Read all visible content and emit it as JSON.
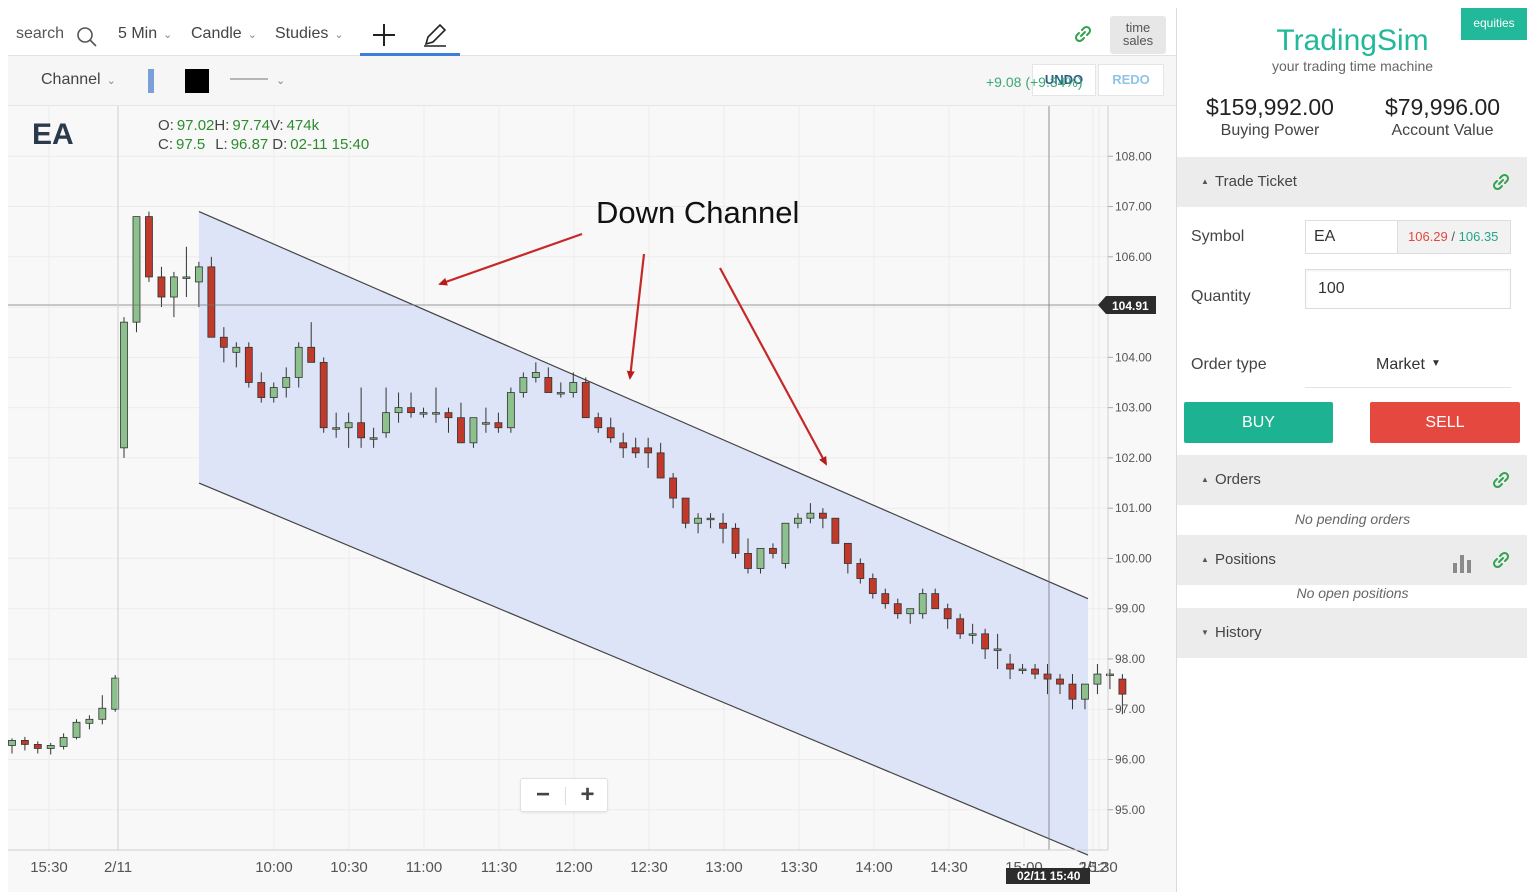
{
  "toolbar": {
    "search_placeholder": "search",
    "interval": "5 Min",
    "chart_type": "Candle",
    "studies": "Studies",
    "time_sales_line1": "time",
    "time_sales_line2": "sales"
  },
  "drawbar": {
    "tool": "Channel",
    "undo": "UNDO",
    "redo": "REDO",
    "change": "+9.08 (+9.34%)",
    "colors": {
      "line_swatch": "#7b9fd8",
      "fill_swatch": "#000000"
    }
  },
  "chart": {
    "symbol": "EA",
    "ohlc": {
      "o_label": "O:",
      "o_value": "97.02",
      "h_label": "H:",
      "h_value": "97.74",
      "v_label": "V:",
      "v_value": "474k",
      "c_label": "C:",
      "c_value": "97.5",
      "l_label": "L:",
      "l_value": "96.87",
      "d_label": "D:",
      "d_value": "02-11 15:40"
    },
    "annotation": "Down Channel",
    "crosshair_price": "104.91",
    "crosshair_time": "02/11 15:40",
    "colors": {
      "up": "#8cc08c",
      "down": "#c0392b",
      "channel_fill": "#dde4f7",
      "arrow": "#c62828"
    }
  },
  "chart_data": {
    "type": "candlestick",
    "y_ticks": [
      "108.00",
      "107.00",
      "106.00",
      "105.00",
      "104.00",
      "103.00",
      "102.00",
      "101.00",
      "100.00",
      "99.00",
      "98.00",
      "97.00",
      "96.00",
      "95.00"
    ],
    "x_ticks": [
      "15:30",
      "2/11",
      "10:00",
      "10:30",
      "11:00",
      "11:30",
      "12:00",
      "12:30",
      "13:00",
      "13:30",
      "14:00",
      "14:30",
      "15:00",
      "15:30",
      "2/12"
    ],
    "ylim": [
      94.2,
      109.0
    ],
    "ohlc": [
      [
        96.28,
        96.42,
        96.12,
        96.38
      ],
      [
        96.38,
        96.45,
        96.18,
        96.3
      ],
      [
        96.3,
        96.36,
        96.12,
        96.22
      ],
      [
        96.22,
        96.33,
        96.1,
        96.28
      ],
      [
        96.26,
        96.52,
        96.2,
        96.44
      ],
      [
        96.44,
        96.8,
        96.4,
        96.74
      ],
      [
        96.72,
        96.88,
        96.6,
        96.8
      ],
      [
        96.8,
        97.28,
        96.7,
        97.02
      ],
      [
        97.0,
        97.68,
        96.95,
        97.62
      ],
      [
        102.2,
        104.8,
        102.0,
        104.7
      ],
      [
        104.7,
        106.8,
        104.5,
        106.8
      ],
      [
        106.8,
        106.9,
        105.5,
        105.6
      ],
      [
        105.6,
        105.8,
        105.0,
        105.2
      ],
      [
        105.2,
        105.7,
        104.8,
        105.6
      ],
      [
        105.6,
        106.2,
        105.2,
        105.6
      ],
      [
        105.5,
        105.9,
        105.0,
        105.8
      ],
      [
        105.8,
        106.0,
        104.4,
        104.4
      ],
      [
        104.4,
        104.6,
        103.9,
        104.2
      ],
      [
        104.1,
        104.3,
        103.8,
        104.2
      ],
      [
        104.2,
        104.3,
        103.4,
        103.5
      ],
      [
        103.5,
        103.7,
        103.1,
        103.2
      ],
      [
        103.2,
        103.5,
        103.1,
        103.4
      ],
      [
        103.4,
        103.8,
        103.2,
        103.6
      ],
      [
        103.6,
        104.3,
        103.4,
        104.2
      ],
      [
        104.2,
        104.7,
        103.9,
        103.9
      ],
      [
        103.9,
        104.0,
        102.5,
        102.6
      ],
      [
        102.6,
        102.9,
        102.4,
        102.6
      ],
      [
        102.6,
        102.9,
        102.2,
        102.7
      ],
      [
        102.7,
        103.4,
        102.2,
        102.4
      ],
      [
        102.4,
        102.6,
        102.2,
        102.4
      ],
      [
        102.5,
        103.4,
        102.4,
        102.9
      ],
      [
        102.9,
        103.3,
        102.7,
        103.0
      ],
      [
        103.0,
        103.3,
        102.8,
        102.9
      ],
      [
        102.9,
        103.0,
        102.8,
        102.9
      ],
      [
        102.9,
        103.4,
        102.7,
        102.9
      ],
      [
        102.9,
        103.0,
        102.5,
        102.8
      ],
      [
        102.8,
        103.1,
        102.3,
        102.3
      ],
      [
        102.3,
        102.8,
        102.2,
        102.8
      ],
      [
        102.7,
        103.0,
        102.5,
        102.7
      ],
      [
        102.7,
        102.9,
        102.5,
        102.6
      ],
      [
        102.6,
        103.4,
        102.5,
        103.3
      ],
      [
        103.3,
        103.7,
        103.2,
        103.6
      ],
      [
        103.6,
        103.9,
        103.5,
        103.7
      ],
      [
        103.6,
        103.8,
        103.3,
        103.3
      ],
      [
        103.3,
        103.5,
        103.2,
        103.3
      ],
      [
        103.3,
        103.7,
        103.2,
        103.5
      ],
      [
        103.5,
        103.6,
        102.8,
        102.8
      ],
      [
        102.8,
        102.9,
        102.5,
        102.6
      ],
      [
        102.6,
        102.8,
        102.3,
        102.4
      ],
      [
        102.3,
        102.5,
        102.0,
        102.2
      ],
      [
        102.2,
        102.4,
        102.0,
        102.1
      ],
      [
        102.2,
        102.4,
        101.8,
        102.1
      ],
      [
        102.1,
        102.3,
        101.6,
        101.6
      ],
      [
        101.6,
        101.7,
        101.0,
        101.2
      ],
      [
        101.2,
        101.2,
        100.6,
        100.7
      ],
      [
        100.7,
        100.9,
        100.5,
        100.8
      ],
      [
        100.8,
        100.9,
        100.6,
        100.8
      ],
      [
        100.7,
        100.9,
        100.3,
        100.6
      ],
      [
        100.6,
        100.7,
        100.0,
        100.1
      ],
      [
        100.1,
        100.4,
        99.7,
        99.8
      ],
      [
        99.8,
        100.2,
        99.7,
        100.2
      ],
      [
        100.2,
        100.3,
        100.0,
        100.1
      ],
      [
        99.9,
        100.7,
        99.8,
        100.7
      ],
      [
        100.7,
        100.9,
        100.6,
        100.8
      ],
      [
        100.8,
        101.1,
        100.7,
        100.9
      ],
      [
        100.9,
        101.0,
        100.6,
        100.8
      ],
      [
        100.8,
        100.8,
        100.3,
        100.3
      ],
      [
        100.3,
        100.3,
        99.7,
        99.9
      ],
      [
        99.9,
        100.0,
        99.5,
        99.6
      ],
      [
        99.6,
        99.7,
        99.2,
        99.3
      ],
      [
        99.3,
        99.4,
        99.0,
        99.1
      ],
      [
        99.1,
        99.2,
        98.8,
        98.9
      ],
      [
        98.9,
        99.0,
        98.7,
        99.0
      ],
      [
        98.9,
        99.4,
        98.8,
        99.3
      ],
      [
        99.3,
        99.4,
        99.0,
        99.0
      ],
      [
        99.0,
        99.1,
        98.6,
        98.8
      ],
      [
        98.8,
        98.9,
        98.4,
        98.5
      ],
      [
        98.5,
        98.7,
        98.3,
        98.5
      ],
      [
        98.5,
        98.6,
        98.0,
        98.2
      ],
      [
        98.2,
        98.5,
        97.8,
        98.2
      ],
      [
        97.9,
        98.1,
        97.6,
        97.8
      ],
      [
        97.8,
        97.9,
        97.7,
        97.8
      ],
      [
        97.8,
        97.9,
        97.6,
        97.7
      ],
      [
        97.7,
        97.9,
        97.3,
        97.6
      ],
      [
        97.6,
        97.7,
        97.3,
        97.5
      ],
      [
        97.5,
        97.7,
        97.0,
        97.2
      ],
      [
        97.2,
        97.5,
        97.0,
        97.5
      ],
      [
        97.5,
        97.9,
        97.3,
        97.7
      ],
      [
        97.7,
        97.8,
        97.4,
        97.7
      ],
      [
        97.6,
        97.7,
        96.9,
        97.3
      ]
    ],
    "channel": {
      "upper": [
        [
          106.9,
          0
        ],
        [
          99.2,
          1
        ]
      ],
      "lower": [
        [
          101.5,
          0
        ],
        [
          94.1,
          1
        ]
      ]
    }
  },
  "zoom": {
    "out": "−",
    "in": "+"
  },
  "sidebar": {
    "badge": "equities",
    "brand": "TradingSim",
    "tagline": "your trading time machine",
    "buying_power": "$159,992.00",
    "buying_power_label": "Buying Power",
    "account_value": "$79,996.00",
    "account_value_label": "Account Value",
    "trade_ticket": "Trade Ticket",
    "symbol_label": "Symbol",
    "symbol_value": "EA",
    "bid": "106.29",
    "ask": "106.35",
    "bid_ask_sep": "/",
    "quantity_label": "Quantity",
    "quantity_value": "100",
    "order_type_label": "Order type",
    "order_type_value": "Market",
    "buy": "BUY",
    "sell": "SELL",
    "orders": "Orders",
    "orders_empty": "No pending orders",
    "positions": "Positions",
    "positions_empty": "No open positions",
    "history": "History",
    "colors": {
      "brand": "#22b89a",
      "buy": "#1db291",
      "sell": "#e5483e",
      "bid": "#e5483e",
      "ask": "#22a58c"
    }
  }
}
